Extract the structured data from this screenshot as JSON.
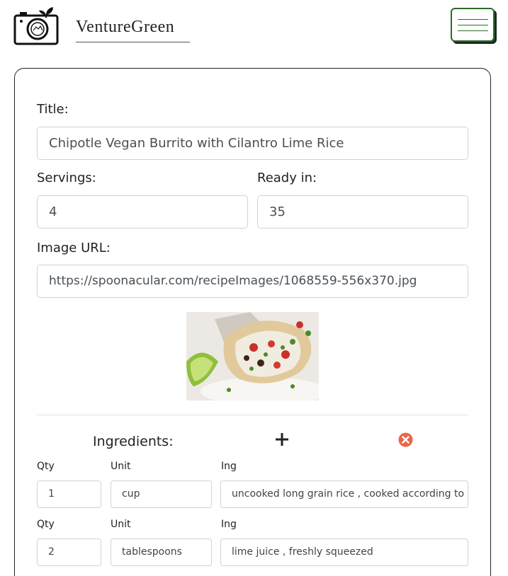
{
  "header": {
    "brand": "VentureGreen"
  },
  "form": {
    "title_label": "Title:",
    "title_value": "Chipotle Vegan Burrito with Cilantro Lime Rice",
    "servings_label": "Servings:",
    "servings_value": "4",
    "ready_label": "Ready in:",
    "ready_value": "35",
    "image_label": "Image URL:",
    "image_value": "https://spoonacular.com/recipeImages/1068559-556x370.jpg"
  },
  "ingredients": {
    "heading": "Ingredients:",
    "headers": {
      "qty": "Qty",
      "unit": "Unit",
      "ing": "Ing"
    },
    "rows": [
      {
        "qty": "1",
        "unit": "cup",
        "ing": "uncooked long grain rice , cooked according to package directions"
      },
      {
        "qty": "2",
        "unit": "tablespoons",
        "ing": "lime juice , freshly squeezed"
      }
    ]
  },
  "colors": {
    "brand_green": "#2e6b2a",
    "remove_icon": "#e8674a"
  }
}
